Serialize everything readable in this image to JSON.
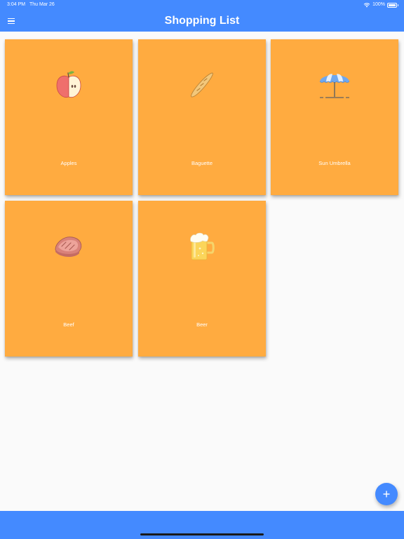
{
  "status_bar": {
    "time": "3:04 PM",
    "date": "Thu Mar 26",
    "battery": "100%"
  },
  "header": {
    "title": "Shopping List",
    "menu_icon": "hamburger-menu-icon"
  },
  "items": [
    {
      "label": "Apples",
      "icon": "apple-icon"
    },
    {
      "label": "Baguette",
      "icon": "baguette-icon"
    },
    {
      "label": "Sun Umbrella",
      "icon": "sun-umbrella-icon"
    },
    {
      "label": "Beef",
      "icon": "steak-icon"
    },
    {
      "label": "Beer",
      "icon": "beer-mug-icon"
    }
  ],
  "fab": {
    "icon": "plus-icon"
  },
  "colors": {
    "primary": "#448aff",
    "card": "#ffab40",
    "background": "#fafafa"
  }
}
